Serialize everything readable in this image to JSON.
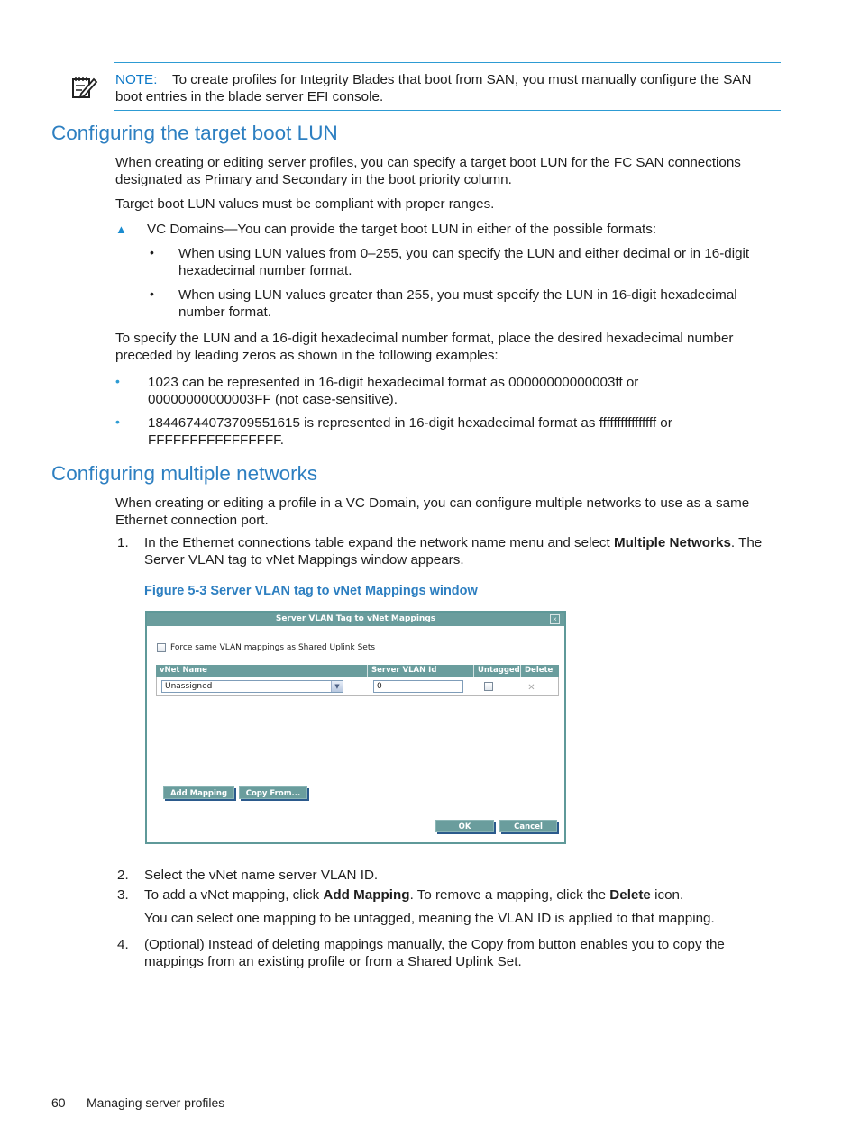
{
  "note": {
    "icon": "note-pencil-icon",
    "label": "NOTE:",
    "text_line1": "To create profiles for Integrity Blades that boot from SAN, you must manually configure the SAN",
    "text_line2": "boot entries in the blade server EFI console."
  },
  "section1": {
    "heading": "Configuring the target boot LUN",
    "para1_line1": "When creating or editing server profiles, you can specify a target boot LUN for the FC SAN connections",
    "para1_line2": "designated as Primary and Secondary in the boot priority column.",
    "para2": "Target boot LUN values must be compliant with proper ranges.",
    "tri_item": "VC Domains—You can provide the target boot LUN in either of the possible formats:",
    "sub_items": [
      {
        "line1": "When using LUN values from 0–255, you can specify the LUN and either decimal or in 16-digit",
        "line2": "hexadecimal number format."
      },
      {
        "line1": "When using LUN values greater than 255, you must specify the LUN in 16-digit hexadecimal",
        "line2": "number format."
      }
    ],
    "para3_line1": "To specify the LUN and a 16-digit hexadecimal number format, place the desired hexadecimal number",
    "para3_line2": "preceded by leading zeros as shown in the following examples:",
    "examples": [
      {
        "line1": "1023 can be represented in 16-digit hexadecimal format as 00000000000003ff or",
        "line2": "00000000000003FF (not case-sensitive)."
      },
      {
        "line1": "18446744073709551615 is represented in 16-digit hexadecimal format as ffffffffffffffff or",
        "line2": "FFFFFFFFFFFFFFFF."
      }
    ]
  },
  "section2": {
    "heading": "Configuring multiple networks",
    "para1_line1": "When creating or editing a profile in a VC Domain, you can configure multiple networks to use as a same",
    "para1_line2": "Ethernet connection port.",
    "step1": {
      "num": "1.",
      "pre": "In the Ethernet connections table expand the network name menu and select ",
      "bold": "Multiple Networks",
      "post": ". The",
      "line2": "Server VLAN tag to vNet Mappings window appears."
    },
    "figure_caption": "Figure 5-3 Server VLAN tag to vNet Mappings window",
    "step2": {
      "num": "2.",
      "text": "Select the vNet name server VLAN ID."
    },
    "step3": {
      "num": "3.",
      "pre": "To add a vNet mapping, click ",
      "bold1": "Add Mapping",
      "mid": ". To remove a mapping, click the ",
      "bold2": "Delete",
      "post": " icon.",
      "extra": "You can select one mapping to be untagged, meaning the VLAN ID is applied to that mapping."
    },
    "step4": {
      "num": "4.",
      "line1": "(Optional) Instead of deleting mappings manually, the Copy from button enables you to copy the",
      "line2": "mappings from an existing profile or from a Shared Uplink Set."
    }
  },
  "dialog": {
    "title": "Server VLAN Tag to vNet Mappings",
    "close_glyph": "×",
    "force_checkbox_label": "Force same VLAN mappings as Shared Uplink Sets",
    "force_checked": false,
    "columns": [
      "vNet Name",
      "Server VLAN Id",
      "Untagged",
      "Delete"
    ],
    "rows": [
      {
        "vnet_name": "Unassigned",
        "vlan_id": "0",
        "untagged": false,
        "delete_glyph": "✕"
      }
    ],
    "dropdown_glyph": "⌄",
    "buttons": {
      "add_mapping": "Add Mapping",
      "copy_from": "Copy From...",
      "ok": "OK",
      "cancel": "Cancel"
    }
  },
  "footer": {
    "page_number": "60",
    "chapter": "Managing server profiles"
  }
}
